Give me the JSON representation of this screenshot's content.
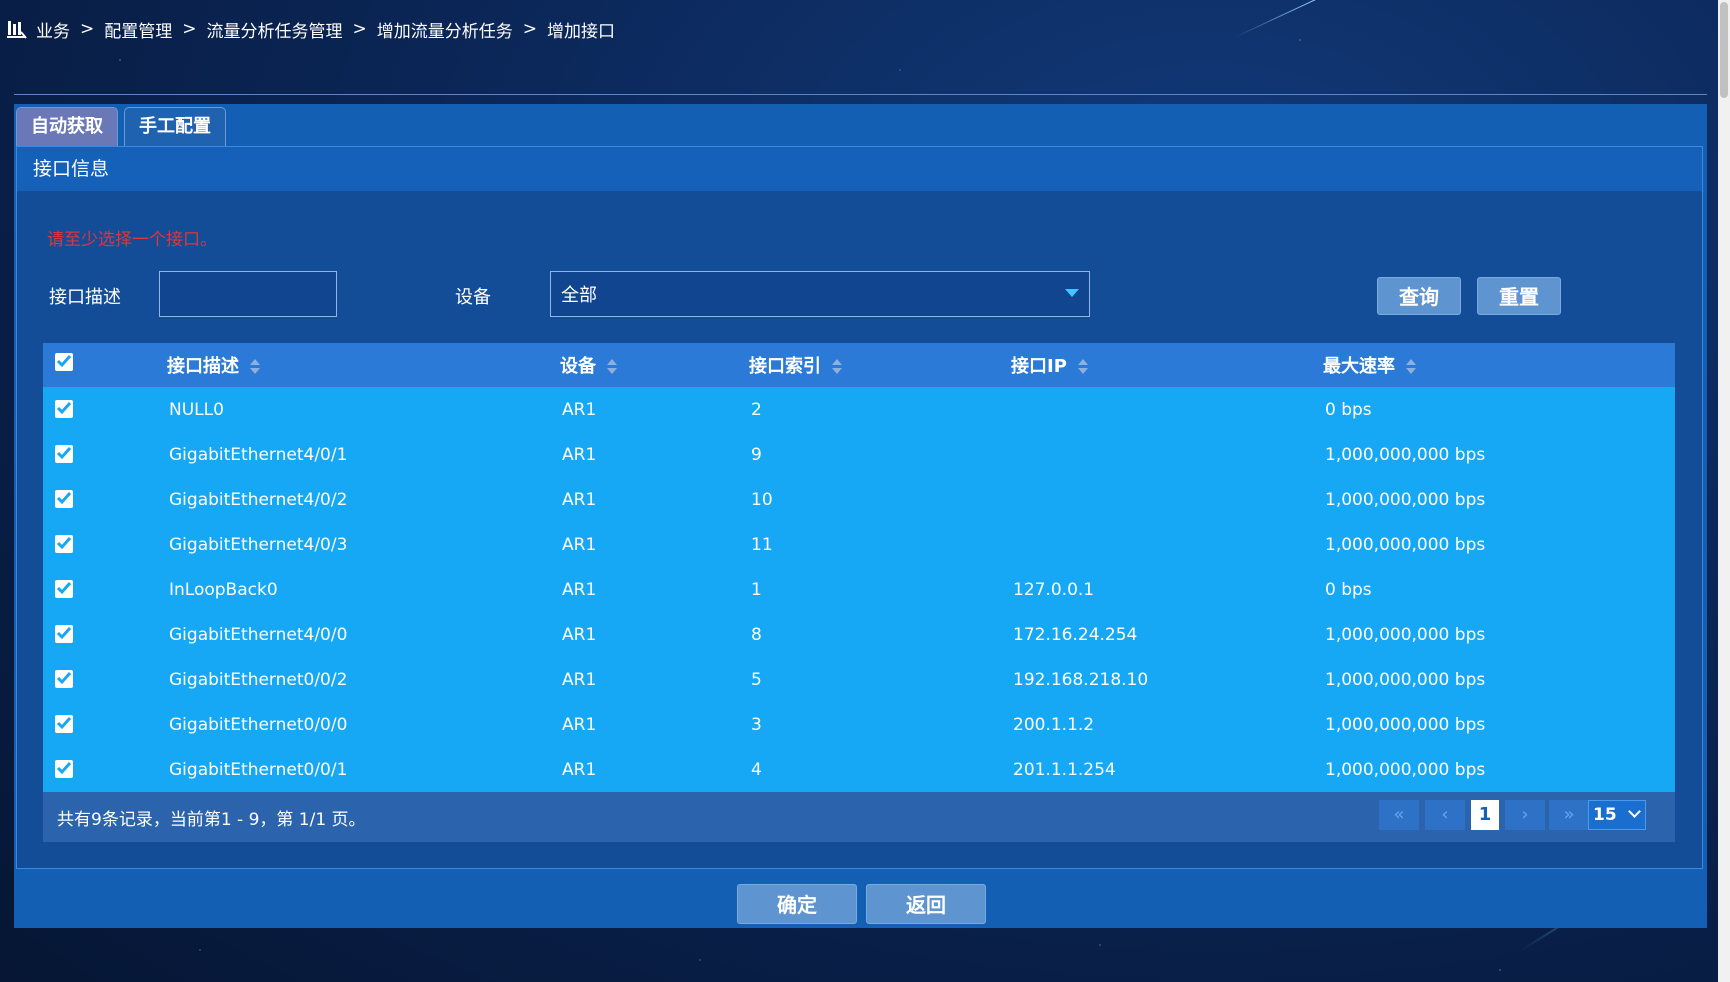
{
  "breadcrumb": {
    "items": [
      "业务",
      "配置管理",
      "流量分析任务管理",
      "增加流量分析任务",
      "增加接口"
    ],
    "separator": ">"
  },
  "tabs": [
    {
      "label": "自动获取",
      "active": true
    },
    {
      "label": "手工配置",
      "active": false
    }
  ],
  "section": {
    "title": "接口信息"
  },
  "warning": "请至少选择一个接口。",
  "filters": {
    "desc_label": "接口描述",
    "desc_value": "",
    "device_label": "设备",
    "device_value": "全部",
    "query_button": "查询",
    "reset_button": "重置"
  },
  "table": {
    "columns": [
      "接口描述",
      "设备",
      "接口索引",
      "接口IP",
      "最大速率"
    ],
    "rows": [
      {
        "checked": true,
        "desc": "NULL0",
        "device": "AR1",
        "index": "2",
        "ip": "",
        "rate": "0 bps"
      },
      {
        "checked": true,
        "desc": "GigabitEthernet4/0/1",
        "device": "AR1",
        "index": "9",
        "ip": "",
        "rate": "1,000,000,000 bps"
      },
      {
        "checked": true,
        "desc": "GigabitEthernet4/0/2",
        "device": "AR1",
        "index": "10",
        "ip": "",
        "rate": "1,000,000,000 bps"
      },
      {
        "checked": true,
        "desc": "GigabitEthernet4/0/3",
        "device": "AR1",
        "index": "11",
        "ip": "",
        "rate": "1,000,000,000 bps"
      },
      {
        "checked": true,
        "desc": "InLoopBack0",
        "device": "AR1",
        "index": "1",
        "ip": "127.0.0.1",
        "rate": "0 bps"
      },
      {
        "checked": true,
        "desc": "GigabitEthernet4/0/0",
        "device": "AR1",
        "index": "8",
        "ip": "172.16.24.254",
        "rate": "1,000,000,000 bps"
      },
      {
        "checked": true,
        "desc": "GigabitEthernet0/0/2",
        "device": "AR1",
        "index": "5",
        "ip": "192.168.218.10",
        "rate": "1,000,000,000 bps"
      },
      {
        "checked": true,
        "desc": "GigabitEthernet0/0/0",
        "device": "AR1",
        "index": "3",
        "ip": "200.1.1.2",
        "rate": "1,000,000,000 bps"
      },
      {
        "checked": true,
        "desc": "GigabitEthernet0/0/1",
        "device": "AR1",
        "index": "4",
        "ip": "201.1.1.254",
        "rate": "1,000,000,000 bps"
      }
    ]
  },
  "pager": {
    "info": "共有9条记录，当前第1 - 9，第 1/1 页。",
    "first": "«",
    "prev": "‹",
    "current": "1",
    "next": "›",
    "last": "»",
    "page_size": "15"
  },
  "footer": {
    "confirm": "确定",
    "back": "返回"
  },
  "colors": {
    "row_bg": "#16a8f5",
    "header_bg": "#2b7ad8",
    "panel_bg": "#135fb4",
    "warning": "#e0353a"
  }
}
